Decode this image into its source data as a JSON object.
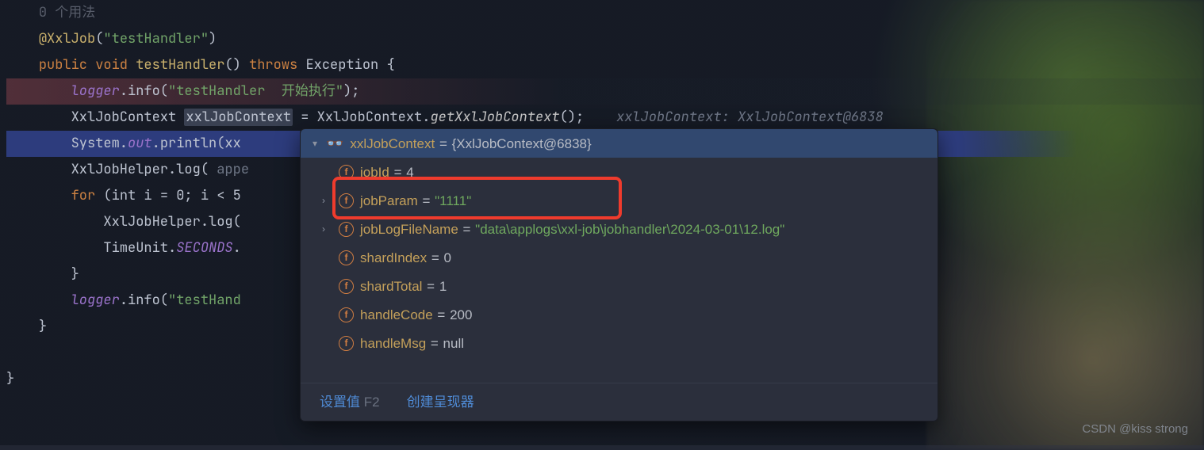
{
  "code": {
    "usages_hint": "0 个用法",
    "annotation_name": "@XxlJob",
    "annotation_value": "\"testHandler\"",
    "method_sig_public": "public void",
    "method_name": "testHandler",
    "method_throws": " throws ",
    "exception": "Exception",
    "logger_var": "logger",
    "info_call": ".info(",
    "log_start_str": "\"testHandler  开始执行\"",
    "ctx_type": "XxlJobContext",
    "ctx_var": "xxlJobContext",
    "ctx_assign": " = XxlJobContext.",
    "ctx_static": "getXxlJobContext",
    "ctx_inline_hint": "xxlJobContext: XxlJobContext@6838",
    "println_pre": "System.",
    "println_out": "out",
    "println_post": ".println(xx",
    "helper": "XxlJobHelper",
    "helper_log": ".log(",
    "helper_param_hint": "appe",
    "for_kw": "for",
    "for_rest": " (int i = 0; i < 5",
    "inner_log_call": ".log(",
    "timeunit": "TimeUnit.",
    "seconds": "SECONDS",
    "logger_end_str": "\"testHand"
  },
  "popup": {
    "root_name": "xxlJobContext",
    "root_value": "{XxlJobContext@6838}",
    "items": [
      {
        "name": "jobId",
        "value": "4",
        "str": false,
        "expandable": false
      },
      {
        "name": "jobParam",
        "value": "\"1111\"",
        "str": true,
        "expandable": true
      },
      {
        "name": "jobLogFileName",
        "value": "\"data\\applogs\\xxl-job\\jobhandler\\2024-03-01\\12.log\"",
        "str": true,
        "expandable": true
      },
      {
        "name": "shardIndex",
        "value": "0",
        "str": false,
        "expandable": false
      },
      {
        "name": "shardTotal",
        "value": "1",
        "str": false,
        "expandable": false
      },
      {
        "name": "handleCode",
        "value": "200",
        "str": false,
        "expandable": false
      },
      {
        "name": "handleMsg",
        "value": "null",
        "str": false,
        "expandable": false
      }
    ],
    "footer_set": "设置值",
    "footer_key": "F2",
    "footer_create": "创建呈现器"
  },
  "watermark": "CSDN @kiss strong"
}
